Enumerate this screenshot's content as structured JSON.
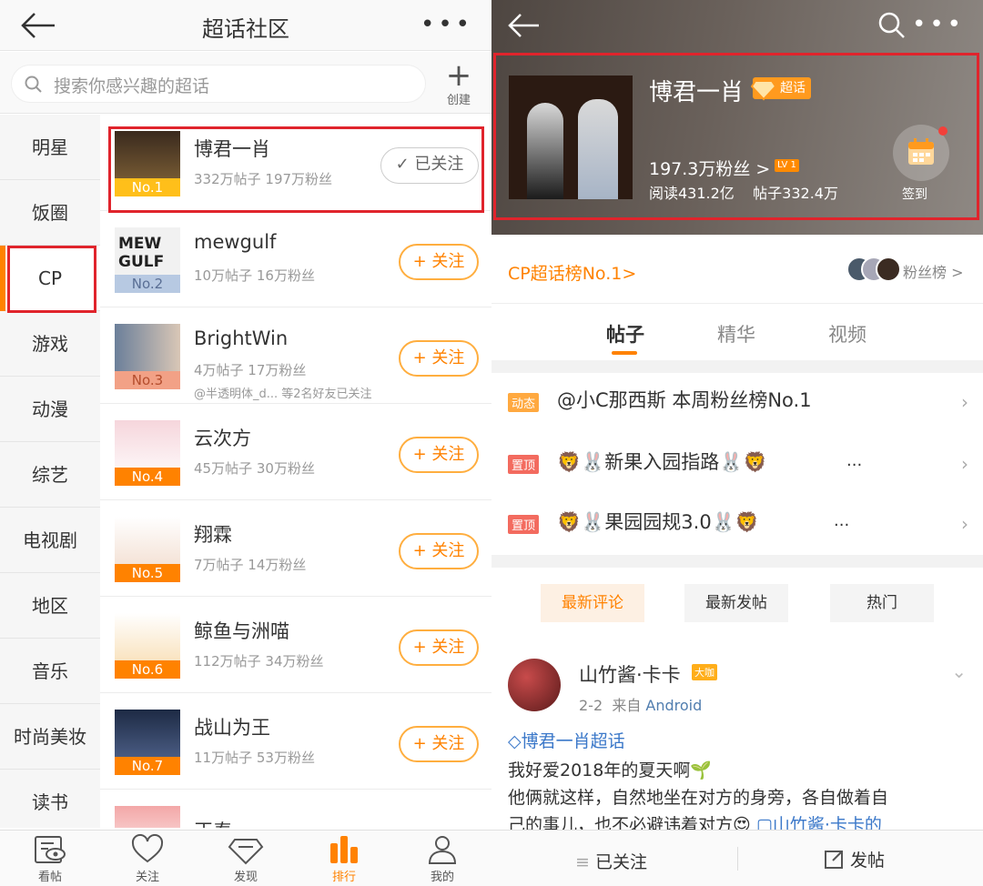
{
  "left": {
    "header": {
      "title": "超话社区"
    },
    "search": {
      "placeholder": "搜索你感兴趣的超话",
      "create_label": "创建"
    },
    "categories": [
      {
        "label": "明星"
      },
      {
        "label": "饭圈"
      },
      {
        "label": "CP"
      },
      {
        "label": "游戏"
      },
      {
        "label": "动漫"
      },
      {
        "label": "综艺"
      },
      {
        "label": "电视剧"
      },
      {
        "label": "地区"
      },
      {
        "label": "音乐"
      },
      {
        "label": "时尚美妆"
      },
      {
        "label": "读书"
      }
    ],
    "active_category": "CP",
    "items": [
      {
        "rank": "No.1",
        "name": "博君一肖",
        "stats": "332万帖子 197万粉丝",
        "sub": "",
        "button": "已关注"
      },
      {
        "rank": "No.2",
        "name": "mewgulf",
        "stats": "10万帖子 16万粉丝",
        "sub": "",
        "button": "关注",
        "thumb_text": "MEW GULF"
      },
      {
        "rank": "No.3",
        "name": "BrightWin",
        "stats": "4万帖子 17万粉丝",
        "sub": "@半透明体_d... 等2名好友已关注",
        "button": "关注"
      },
      {
        "rank": "No.4",
        "name": "云次方",
        "stats": "45万帖子 30万粉丝",
        "sub": "",
        "button": "关注"
      },
      {
        "rank": "No.5",
        "name": "翔霖",
        "stats": "7万帖子 14万粉丝",
        "sub": "",
        "button": "关注"
      },
      {
        "rank": "No.6",
        "name": "鲸鱼与洲喵",
        "stats": "112万帖子 34万粉丝",
        "sub": "",
        "button": "关注"
      },
      {
        "rank": "No.7",
        "name": "战山为王",
        "stats": "11万帖子 53万粉丝",
        "sub": "",
        "button": "关注"
      },
      {
        "rank": "",
        "name": "正泰",
        "stats": "",
        "sub": "",
        "button": ""
      }
    ],
    "tabbar": [
      {
        "label": "看帖",
        "icon": "eye-doc-icon"
      },
      {
        "label": "关注",
        "icon": "heart-icon"
      },
      {
        "label": "发现",
        "icon": "diamond-icon"
      },
      {
        "label": "排行",
        "icon": "bar-chart-icon"
      },
      {
        "label": "我的",
        "icon": "person-icon"
      }
    ],
    "active_tab": "排行"
  },
  "right": {
    "title": "博君一肖",
    "badge": "超话",
    "fans": "197.3万粉丝 >",
    "level": "LV 1",
    "reads": "阅读431.2亿",
    "posts": "帖子332.4万",
    "checkin_label": "签到",
    "rank_text": "CP超话榜No.1>",
    "fan_rank_label": "粉丝榜 >",
    "tabs": [
      "帖子",
      "精华",
      "视频"
    ],
    "active_tab": "帖子",
    "pinned": [
      {
        "tag": "动态",
        "text": "@小C那西斯 本周粉丝榜No.1",
        "dots": ""
      },
      {
        "tag": "置顶",
        "text": "🦁🐰新果入园指路🐰🦁",
        "dots": "..."
      },
      {
        "tag": "置顶",
        "text": "🦁🐰果园园规3.0🐰🦁",
        "dots": "..."
      }
    ],
    "filters": [
      "最新评论",
      "最新发帖",
      "热门"
    ],
    "active_filter": "最新评论",
    "post": {
      "user": "山竹酱·卡卡",
      "vip": "大咖",
      "date": "2-2",
      "from": "来自",
      "source": "Android",
      "topic": "博君一肖超话",
      "line1": "我好爱2018年的夏天啊🌱",
      "line2": "他俩就这样，自然地坐在对方的身旁，各自做着自",
      "line3": "己的事儿，也不必避讳着对方😍",
      "link": "山竹酱·卡卡的"
    },
    "bottom": {
      "followed": "已关注",
      "post": "发帖"
    }
  }
}
